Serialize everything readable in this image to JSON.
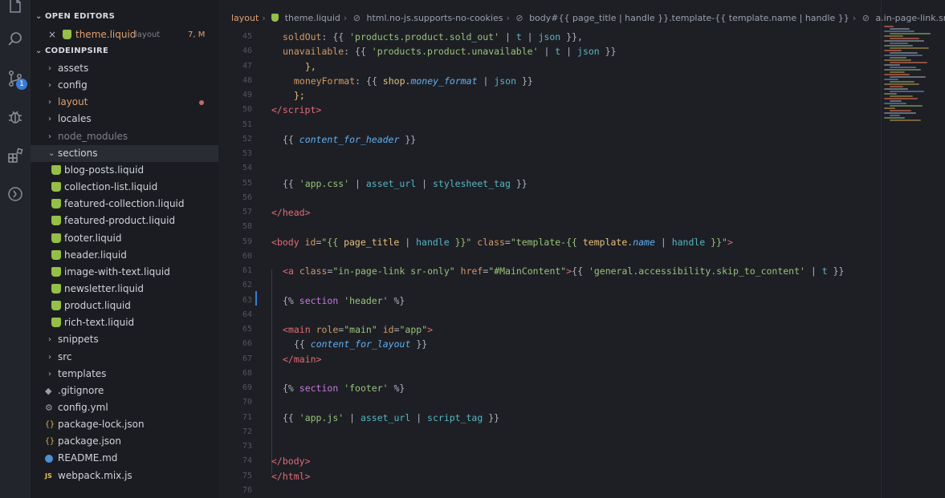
{
  "sidebar": {
    "open_editors_label": "OPEN EDITORS",
    "open_editor": {
      "name": "theme.liquid",
      "folder": "layout",
      "status": "7, M",
      "close": "×"
    },
    "project_label": "CODEINPSIRE",
    "tree": [
      {
        "label": "assets",
        "type": "folder",
        "depth": 0
      },
      {
        "label": "config",
        "type": "folder",
        "depth": 0
      },
      {
        "label": "layout",
        "type": "folder",
        "depth": 0,
        "modified": true
      },
      {
        "label": "locales",
        "type": "folder",
        "depth": 0
      },
      {
        "label": "node_modules",
        "type": "folder",
        "depth": 0,
        "dim": true
      },
      {
        "label": "sections",
        "type": "folder-open",
        "depth": 0,
        "active": true
      },
      {
        "label": "blog-posts.liquid",
        "type": "liquid",
        "depth": 1
      },
      {
        "label": "collection-list.liquid",
        "type": "liquid",
        "depth": 1
      },
      {
        "label": "featured-collection.liquid",
        "type": "liquid",
        "depth": 1
      },
      {
        "label": "featured-product.liquid",
        "type": "liquid",
        "depth": 1
      },
      {
        "label": "footer.liquid",
        "type": "liquid",
        "depth": 1
      },
      {
        "label": "header.liquid",
        "type": "liquid",
        "depth": 1
      },
      {
        "label": "image-with-text.liquid",
        "type": "liquid",
        "depth": 1
      },
      {
        "label": "newsletter.liquid",
        "type": "liquid",
        "depth": 1
      },
      {
        "label": "product.liquid",
        "type": "liquid",
        "depth": 1
      },
      {
        "label": "rich-text.liquid",
        "type": "liquid",
        "depth": 1
      },
      {
        "label": "snippets",
        "type": "folder",
        "depth": 0
      },
      {
        "label": "src",
        "type": "folder",
        "depth": 0
      },
      {
        "label": "templates",
        "type": "folder",
        "depth": 0
      },
      {
        "label": ".gitignore",
        "type": "git",
        "depth": 0
      },
      {
        "label": "config.yml",
        "type": "gear",
        "depth": 0
      },
      {
        "label": "package-lock.json",
        "type": "json",
        "depth": 0
      },
      {
        "label": "package.json",
        "type": "json",
        "depth": 0
      },
      {
        "label": "README.md",
        "type": "info",
        "depth": 0
      },
      {
        "label": "webpack.mix.js",
        "type": "js",
        "depth": 0
      }
    ]
  },
  "breadcrumb": [
    "layout",
    "theme.liquid",
    "html.no-js.supports-no-cookies",
    "body#{{ page_title | handle }}.template-{{ template.name | handle }}",
    "a.in-page-link.sr-on"
  ],
  "activity_badge": "1",
  "colors": {
    "tag": "#e06c75",
    "attr": "#d19a66",
    "string": "#98c379",
    "variable": "#61afef",
    "object": "#e5c07b",
    "keyword": "#c678dd",
    "filter": "#56b6c2"
  },
  "icons": [
    "files-icon",
    "search-icon",
    "source-control-icon",
    "debug-icon",
    "extensions-icon",
    "remote-icon"
  ],
  "code_lines": [
    {
      "n": "45",
      "tokens": [
        [
          "      ",
          "p"
        ],
        [
          "soldOut",
          "a"
        ],
        [
          ": {{ ",
          "p"
        ],
        [
          "'products.product.sold_out'",
          "s"
        ],
        [
          " | ",
          "p"
        ],
        [
          "t",
          "f"
        ],
        [
          " | ",
          "p"
        ],
        [
          "json",
          "f"
        ],
        [
          " }},",
          "p"
        ]
      ]
    },
    {
      "n": "46",
      "tokens": [
        [
          "      ",
          "p"
        ],
        [
          "unavailable",
          "a"
        ],
        [
          ": {{ ",
          "p"
        ],
        [
          "'products.product.unavailable'",
          "s"
        ],
        [
          " | ",
          "p"
        ],
        [
          "t",
          "f"
        ],
        [
          " | ",
          "p"
        ],
        [
          "json",
          "f"
        ],
        [
          " }}",
          "p"
        ]
      ]
    },
    {
      "n": "47",
      "tokens": [
        [
          "    },",
          "y"
        ]
      ]
    },
    {
      "n": "48",
      "tokens": [
        [
          "    ",
          "p"
        ],
        [
          "moneyFormat",
          "a"
        ],
        [
          ": {{ ",
          "p"
        ],
        [
          "shop",
          "o"
        ],
        [
          ".",
          "p"
        ],
        [
          "money_format",
          "v"
        ],
        [
          " | ",
          "p"
        ],
        [
          "json",
          "f"
        ],
        [
          " }}",
          "p"
        ]
      ]
    },
    {
      "n": "49",
      "tokens": [
        [
          "  };",
          "y"
        ]
      ]
    },
    {
      "n": "50",
      "tokens": [
        [
          "</",
          "t"
        ],
        [
          "script",
          "t"
        ],
        [
          ">",
          "t"
        ]
      ]
    },
    {
      "n": "51",
      "tokens": []
    },
    {
      "n": "52",
      "tokens": [
        [
          "{{ ",
          "p"
        ],
        [
          "content_for_header",
          "v"
        ],
        [
          " }}",
          "p"
        ]
      ]
    },
    {
      "n": "53",
      "tokens": []
    },
    {
      "n": "54",
      "tokens": []
    },
    {
      "n": "55",
      "tokens": [
        [
          "{{ ",
          "p"
        ],
        [
          "'app.css'",
          "s"
        ],
        [
          " | ",
          "p"
        ],
        [
          "asset_url",
          "f"
        ],
        [
          " | ",
          "p"
        ],
        [
          "stylesheet_tag",
          "f"
        ],
        [
          " }}",
          "p"
        ]
      ]
    },
    {
      "n": "56",
      "tokens": []
    },
    {
      "n": "57",
      "tokens": [
        [
          "</",
          "t"
        ],
        [
          "head",
          "t"
        ],
        [
          ">",
          "t"
        ]
      ]
    },
    {
      "n": "58",
      "tokens": []
    },
    {
      "n": "59",
      "tokens": [
        [
          "<",
          "t"
        ],
        [
          "body",
          "t"
        ],
        [
          " ",
          "p"
        ],
        [
          "id",
          "a"
        ],
        [
          "=",
          "p"
        ],
        [
          "\"{{ ",
          "s"
        ],
        [
          "page_title",
          "o"
        ],
        [
          " | ",
          "p"
        ],
        [
          "handle",
          "f"
        ],
        [
          " }}\"",
          "s"
        ],
        [
          " ",
          "p"
        ],
        [
          "class",
          "a"
        ],
        [
          "=",
          "p"
        ],
        [
          "\"template-{{ ",
          "s"
        ],
        [
          "template",
          "o"
        ],
        [
          ".",
          "p"
        ],
        [
          "name",
          "v"
        ],
        [
          " | ",
          "p"
        ],
        [
          "handle",
          "f"
        ],
        [
          " }}\"",
          "s"
        ],
        [
          ">",
          "t"
        ]
      ]
    },
    {
      "n": "60",
      "tokens": []
    },
    {
      "n": "61",
      "tokens": [
        [
          "<",
          "t"
        ],
        [
          "a",
          "t"
        ],
        [
          " ",
          "p"
        ],
        [
          "class",
          "a"
        ],
        [
          "=",
          "p"
        ],
        [
          "\"in-page-link sr-only\"",
          "s"
        ],
        [
          " ",
          "p"
        ],
        [
          "href",
          "a"
        ],
        [
          "=",
          "p"
        ],
        [
          "\"#MainContent\"",
          "s"
        ],
        [
          ">",
          "t"
        ],
        [
          "{{ ",
          "p"
        ],
        [
          "'general.accessibility.skip_to_content'",
          "s"
        ],
        [
          " | ",
          "p"
        ],
        [
          "t",
          "f"
        ],
        [
          " }}",
          "p"
        ]
      ]
    },
    {
      "n": "62",
      "tokens": []
    },
    {
      "n": "63",
      "tokens": [
        [
          "{% ",
          "p"
        ],
        [
          "section",
          "k"
        ],
        [
          " ",
          "p"
        ],
        [
          "'header'",
          "s"
        ],
        [
          " %}",
          "p"
        ]
      ]
    },
    {
      "n": "64",
      "tokens": []
    },
    {
      "n": "65",
      "tokens": [
        [
          "<",
          "t"
        ],
        [
          "main",
          "t"
        ],
        [
          " ",
          "p"
        ],
        [
          "role",
          "a"
        ],
        [
          "=",
          "p"
        ],
        [
          "\"main\"",
          "s"
        ],
        [
          " ",
          "p"
        ],
        [
          "id",
          "a"
        ],
        [
          "=",
          "p"
        ],
        [
          "\"app\"",
          "s"
        ],
        [
          ">",
          "t"
        ]
      ]
    },
    {
      "n": "66",
      "tokens": [
        [
          "  {{ ",
          "p"
        ],
        [
          "content_for_layout",
          "v"
        ],
        [
          " }}",
          "p"
        ]
      ]
    },
    {
      "n": "67",
      "tokens": [
        [
          "</",
          "t"
        ],
        [
          "main",
          "t"
        ],
        [
          ">",
          "t"
        ]
      ]
    },
    {
      "n": "68",
      "tokens": []
    },
    {
      "n": "69",
      "tokens": [
        [
          "{% ",
          "p"
        ],
        [
          "section",
          "k"
        ],
        [
          " ",
          "p"
        ],
        [
          "'footer'",
          "s"
        ],
        [
          " %}",
          "p"
        ]
      ]
    },
    {
      "n": "70",
      "tokens": []
    },
    {
      "n": "71",
      "tokens": [
        [
          "{{ ",
          "p"
        ],
        [
          "'app.js'",
          "s"
        ],
        [
          " | ",
          "p"
        ],
        [
          "asset_url",
          "f"
        ],
        [
          " | ",
          "p"
        ],
        [
          "script_tag",
          "f"
        ],
        [
          " }}",
          "p"
        ]
      ]
    },
    {
      "n": "72",
      "tokens": []
    },
    {
      "n": "73",
      "tokens": []
    },
    {
      "n": "74",
      "tokens": [
        [
          "</",
          "t"
        ],
        [
          "body",
          "t"
        ],
        [
          ">",
          "t"
        ]
      ]
    },
    {
      "n": "75",
      "tokens": [
        [
          "</",
          "t"
        ],
        [
          "html",
          "t"
        ],
        [
          ">",
          "t"
        ]
      ]
    },
    {
      "n": "76",
      "tokens": []
    }
  ]
}
